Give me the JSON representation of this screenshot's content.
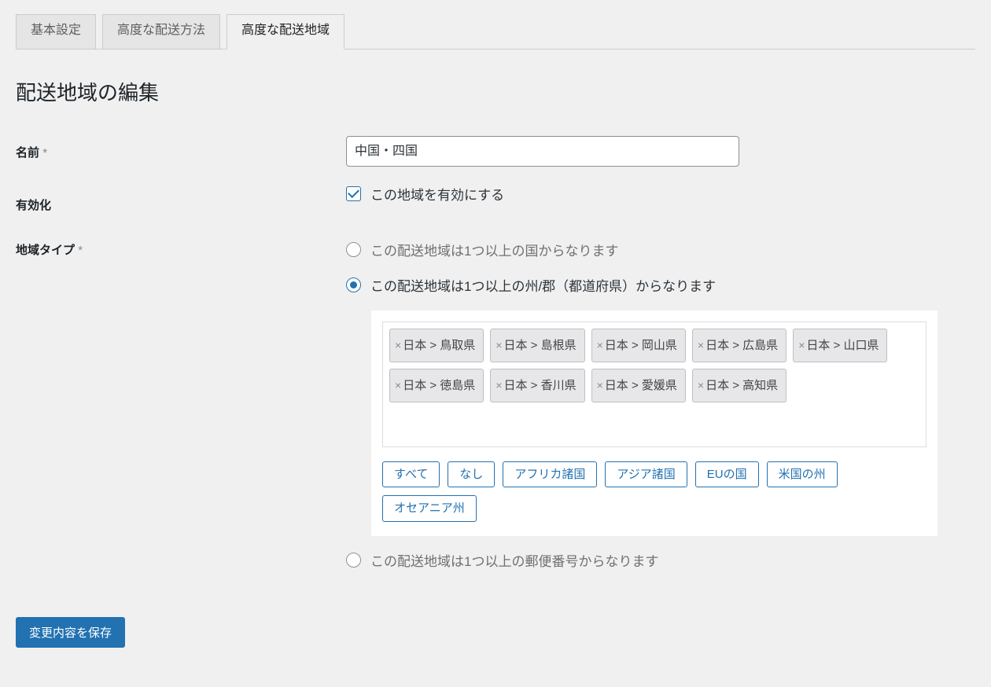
{
  "tabs": [
    {
      "label": "基本設定"
    },
    {
      "label": "高度な配送方法"
    },
    {
      "label": "高度な配送地域"
    }
  ],
  "active_tab": 2,
  "heading": "配送地域の編集",
  "fields": {
    "name": {
      "label": "名前",
      "value": "中国・四国"
    },
    "enabled": {
      "label": "有効化",
      "checked": true,
      "text": "この地域を有効にする"
    },
    "region_type": {
      "label": "地域タイプ",
      "options": {
        "countries": "この配送地域は1つ以上の国からなります",
        "states": "この配送地域は1つ以上の州/郡（都道府県）からなります",
        "postcodes": "この配送地域は1つ以上の郵便番号からなります"
      },
      "selected": "states"
    }
  },
  "states": [
    "日本 > 鳥取県",
    "日本 > 島根県",
    "日本 > 岡山県",
    "日本 > 広島県",
    "日本 > 山口県",
    "日本 > 徳島県",
    "日本 > 香川県",
    "日本 > 愛媛県",
    "日本 > 高知県"
  ],
  "quick_buttons": [
    "すべて",
    "なし",
    "アフリカ諸国",
    "アジア諸国",
    "EUの国",
    "米国の州",
    "オセアニア州"
  ],
  "submit_label": "変更内容を保存"
}
